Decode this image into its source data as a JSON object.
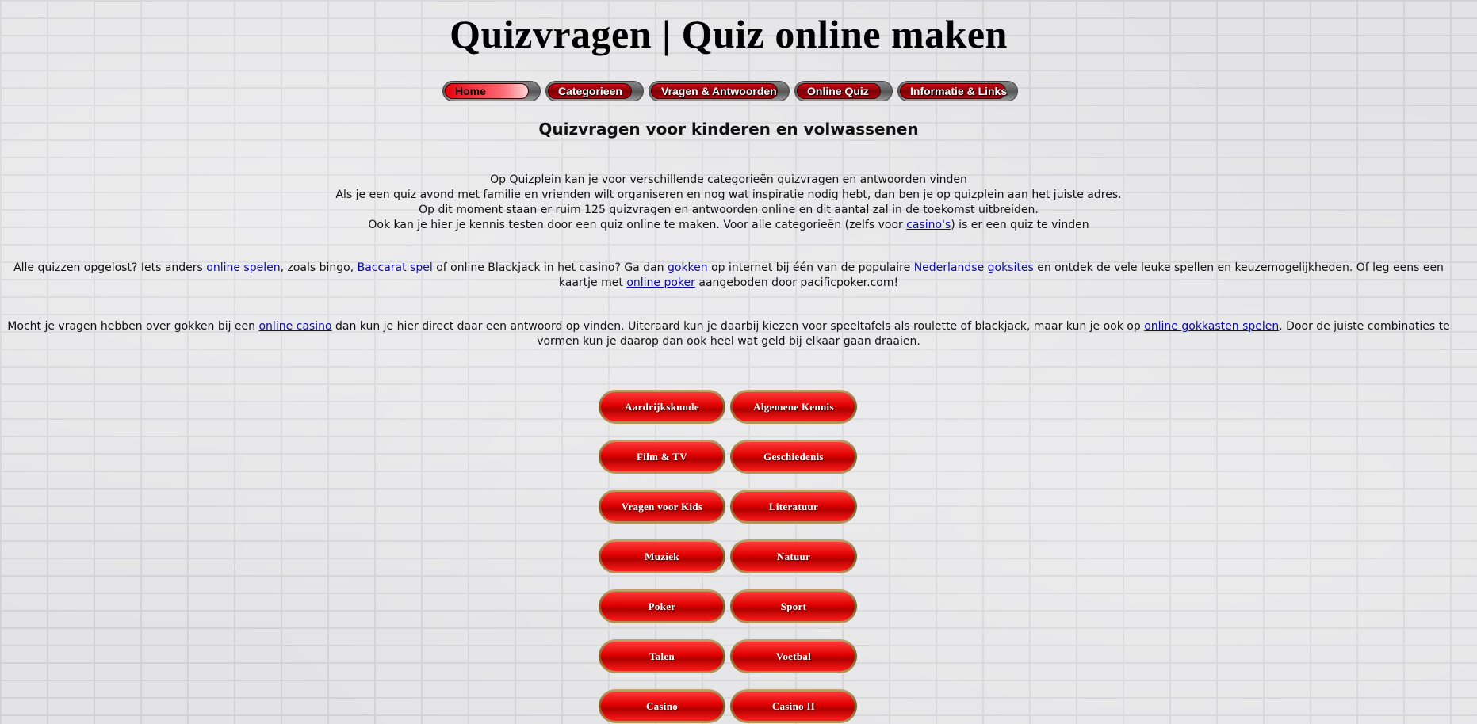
{
  "header": {
    "title": "Quizvragen | Quiz online maken"
  },
  "nav": [
    {
      "label": "Home",
      "active": true
    },
    {
      "label": "Categorieen",
      "active": false
    },
    {
      "label": "Vragen & Antwoorden",
      "active": false
    },
    {
      "label": "Online Quiz",
      "active": false
    },
    {
      "label": "Informatie & Links",
      "active": false
    }
  ],
  "main": {
    "subtitle": "Quizvragen voor kinderen en volwassenen",
    "intro": [
      "Op Quizplein kan je voor verschillende categorieën quizvragen en antwoorden vinden",
      "Als je een quiz avond met familie en vrienden wilt organiseren en nog wat inspiratie nodig hebt, dan ben je op quizplein aan het juiste adres.",
      "Op dit moment staan er ruim 125 quizvragen en antwoorden online en dit aantal zal in de toekomst uitbreiden.",
      "Ook kan je hier je kennis testen door een quiz online te maken. Voor alle categorieën (zelfs voor ",
      "casino's",
      ") is er een quiz te vinden"
    ],
    "para1": {
      "t1": "Alle quizzen opgelost? Iets anders ",
      "l1": "online spelen",
      "t2": ", zoals bingo, ",
      "l2": "Baccarat spel",
      "t3": " of online Blackjack in het casino? Ga dan ",
      "l3": "gokken",
      "t4": " op internet bij één van de populaire ",
      "l4": "Nederlandse goksites",
      "t5": " en ontdek de vele leuke spellen en keuzemogelijkheden. Of leg eens een kaartje met ",
      "l5": "online poker",
      "t6": " aangeboden door pacificpoker.com!"
    },
    "para2": {
      "t1": "Mocht je vragen hebben over gokken bij een ",
      "l1": "online casino",
      "t2": " dan kun je hier direct daar een antwoord op vinden. Uiteraard kun je daarbij kiezen voor speeltafels als roulette of blackjack, maar kun je ook op ",
      "l2": "online gokkasten spelen",
      "t3": ". Door de juiste combinaties te vormen kun je daarop dan ook heel wat geld bij elkaar gaan draaien."
    }
  },
  "categories": [
    "Aardrijkskunde",
    "Algemene Kennis",
    "Film & TV",
    "Geschiedenis",
    "Vragen voor Kids",
    "Literatuur",
    "Muziek",
    "Natuur",
    "Poker",
    "Sport",
    "Talen",
    "Voetbal",
    "Casino",
    "Casino II"
  ]
}
